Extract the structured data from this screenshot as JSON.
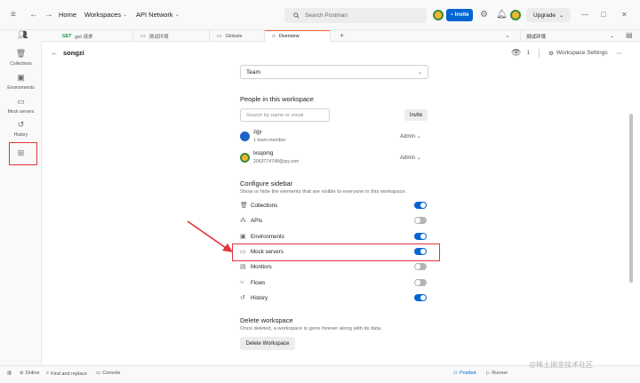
{
  "titlebar": {
    "menu_icon": "≡",
    "home": "Home",
    "workspaces": "Workspaces",
    "api_network": "API Network",
    "search_placeholder": "Search Postman",
    "invite": "Invite",
    "upgrade": "Upgrade",
    "window_min": "—",
    "window_max": "□",
    "window_close": "✕"
  },
  "tabs": [
    {
      "method": "GET",
      "label": "get 请求",
      "active": false
    },
    {
      "method": "",
      "label": "测试环境",
      "active": false
    },
    {
      "method": "",
      "label": "Globals",
      "active": false
    },
    {
      "method": "",
      "label": "Overview",
      "active": true
    }
  ],
  "tabbar": {
    "add_tab": "+",
    "environment": "测试环境"
  },
  "sidebar": {
    "items": [
      {
        "label": "Collections",
        "icon": "collections-icon"
      },
      {
        "label": "Environments",
        "icon": "environments-icon"
      },
      {
        "label": "Mock servers",
        "icon": "mock-servers-icon"
      },
      {
        "label": "History",
        "icon": "history-icon"
      },
      {
        "label": "",
        "icon": "configure-sidebar-icon"
      }
    ]
  },
  "workspace": {
    "name": "songzi",
    "watchers": "1",
    "settings_label": "Workspace Settings"
  },
  "settings": {
    "team_select": "Team",
    "people": {
      "title": "People in this workspace",
      "search_placeholder": "Search by name or email",
      "invite": "Invite",
      "members": [
        {
          "name": "zgy",
          "sub": "1 team member",
          "role": "Admin"
        },
        {
          "name": "lxsqomg",
          "sub": "2063774748@qq.com",
          "role": "Admin"
        }
      ]
    },
    "configure": {
      "title": "Configure sidebar",
      "description": "Show or hide the elements that are visible to everyone in this workspace.",
      "items": [
        {
          "label": "Collections",
          "icon": "collections-icon",
          "enabled": true
        },
        {
          "label": "APIs",
          "icon": "apis-icon",
          "enabled": false
        },
        {
          "label": "Environments",
          "icon": "environments-icon",
          "enabled": true
        },
        {
          "label": "Mock servers",
          "icon": "mock-servers-icon",
          "enabled": true
        },
        {
          "label": "Monitors",
          "icon": "monitors-icon",
          "enabled": false
        },
        {
          "label": "Flows",
          "icon": "flows-icon",
          "enabled": false
        },
        {
          "label": "History",
          "icon": "history-icon",
          "enabled": true
        }
      ]
    },
    "delete": {
      "title": "Delete workspace",
      "description": "Once deleted, a workspace is gone forever along with its data.",
      "button": "Delete Workspace"
    }
  },
  "statusbar": {
    "online": "Online",
    "find_replace": "Find and replace",
    "console": "Console",
    "postbot": "Postbot",
    "runner": "Runner"
  },
  "watermark": "@稀土掘金技术社区",
  "colors": {
    "accent": "#ff6c37",
    "primary": "#0265d2",
    "annotation": "#e0363d"
  }
}
